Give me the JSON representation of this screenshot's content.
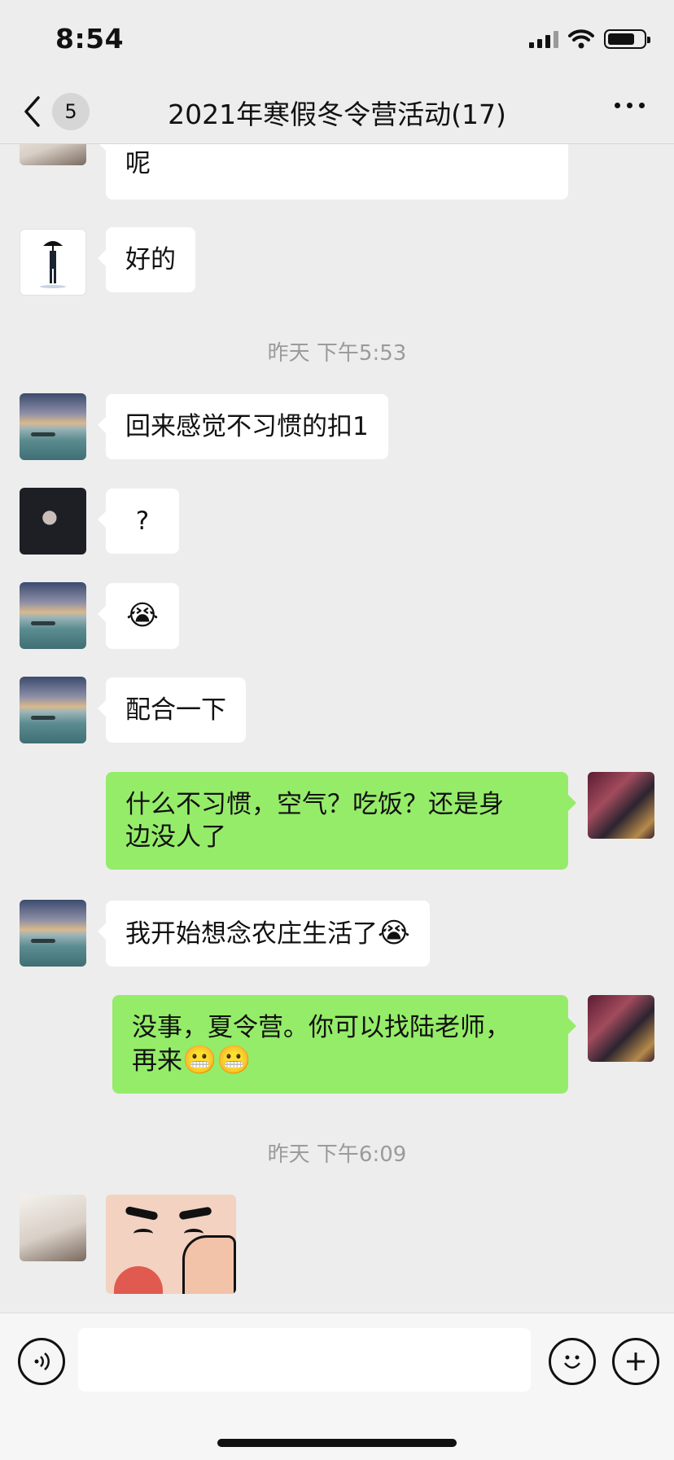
{
  "status_bar": {
    "time": "8:54",
    "battery_level": 0.8
  },
  "header": {
    "unread_count": "5",
    "title": "2021年寒假冬令营活动(17)"
  },
  "messages": {
    "partial_text": "呢",
    "ok": "好的",
    "ts1": "昨天 下午5:53",
    "m1": "回来感觉不习惯的扣1",
    "m2": "?",
    "m3_emoji": "😭",
    "m4": "配合一下",
    "m5_line1": "什么不习惯，空气？吃饭？还是身",
    "m5_line2": "边没人了",
    "m6_text": "我开始想念农庄生活了",
    "m6_emoji": "😭",
    "m7_line1": "没事，夏令营。你可以找陆老师，",
    "m7_line2": "再来",
    "m7_emoji": "😬😬",
    "ts2": "昨天 下午6:09"
  },
  "icons": {
    "voice": "voice-icon",
    "emoji": "emoji-icon",
    "plus": "plus-icon",
    "back": "chevron-left-icon",
    "more": "more-icon"
  }
}
